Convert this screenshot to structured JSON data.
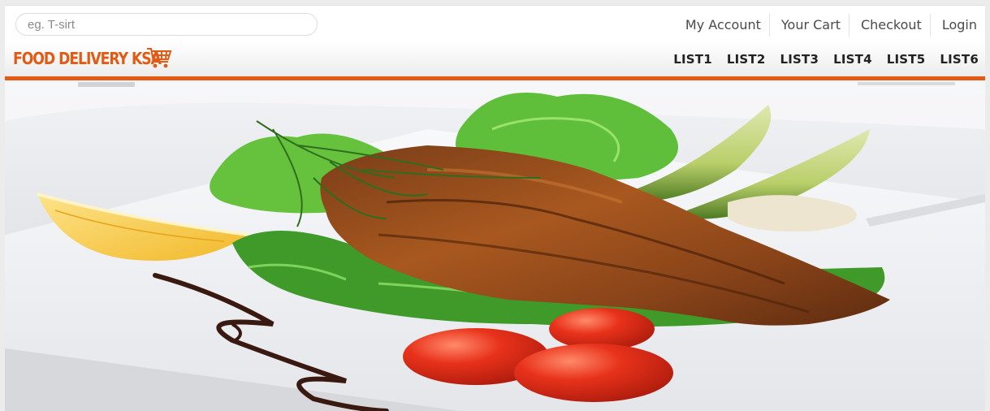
{
  "search": {
    "placeholder": "eg. T-sirt"
  },
  "account_links": [
    "My Account",
    "Your Cart",
    "Checkout",
    "Login"
  ],
  "brand": {
    "name": "FOOD DELIVERY KSA",
    "icon": "shopping-cart-icon",
    "color": "#e25a14"
  },
  "nav": [
    "LIST1",
    "LIST2",
    "LIST3",
    "LIST4",
    "LIST5",
    "LIST6"
  ],
  "colors": {
    "accent": "#e25a14"
  },
  "hero": {
    "image": "grilled-salmon-salad-plate"
  }
}
